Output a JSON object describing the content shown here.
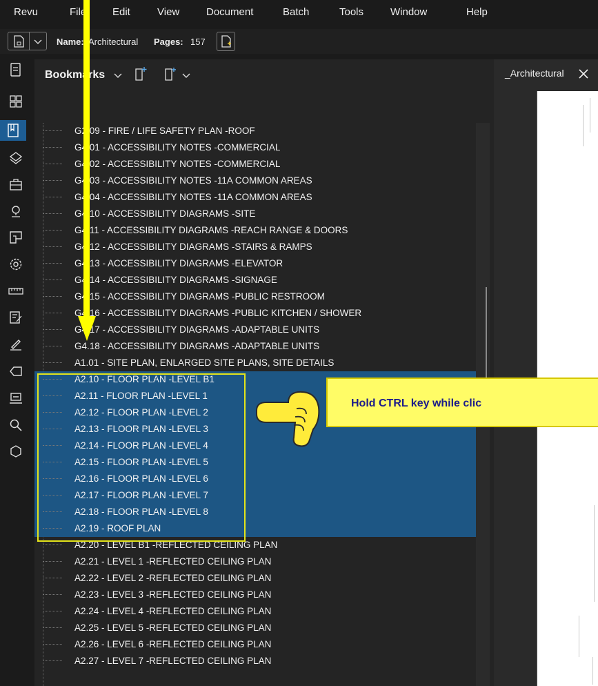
{
  "menubar": {
    "items": [
      "Revu",
      "File",
      "Edit",
      "View",
      "Document",
      "Batch",
      "Tools",
      "Window",
      "Help"
    ]
  },
  "toolbar": {
    "name_label": "Name:",
    "name_value": "Architectural",
    "pages_label": "Pages:",
    "pages_value": "157"
  },
  "sidebar_icons": [
    "page-icon",
    "thumbnails-icon",
    "bookmarks-icon",
    "layers-icon",
    "toolbox-icon",
    "markups-icon",
    "spaces-icon",
    "settings-icon",
    "measure-icon",
    "properties-icon",
    "signature-icon",
    "tags-icon",
    "studio-icon",
    "search-icon",
    "sets-icon"
  ],
  "panel": {
    "title": "Bookmarks"
  },
  "bookmarks": [
    {
      "label": "G2.09 - FIRE / LIFE SAFETY PLAN -ROOF",
      "selected": false
    },
    {
      "label": "G4.01 - ACCESSIBILITY NOTES -COMMERCIAL",
      "selected": false
    },
    {
      "label": "G4.02 - ACCESSIBILITY NOTES -COMMERCIAL",
      "selected": false
    },
    {
      "label": "G4.03 - ACCESSIBILITY NOTES -11A COMMON AREAS",
      "selected": false
    },
    {
      "label": "G4.04 - ACCESSIBILITY NOTES -11A COMMON AREAS",
      "selected": false
    },
    {
      "label": "G4.10 - ACCESSIBILITY DIAGRAMS -SITE",
      "selected": false
    },
    {
      "label": "G4.11 - ACCESSIBILITY DIAGRAMS -REACH RANGE & DOORS",
      "selected": false
    },
    {
      "label": "G4.12 - ACCESSIBILITY DIAGRAMS -STAIRS & RAMPS",
      "selected": false
    },
    {
      "label": "G4.13 - ACCESSIBILITY DIAGRAMS -ELEVATOR",
      "selected": false
    },
    {
      "label": "G4.14 - ACCESSIBILITY DIAGRAMS -SIGNAGE",
      "selected": false
    },
    {
      "label": "G4.15 - ACCESSIBILITY DIAGRAMS -PUBLIC RESTROOM",
      "selected": false
    },
    {
      "label": "G4.16 - ACCESSIBILITY DIAGRAMS -PUBLIC KITCHEN / SHOWER",
      "selected": false
    },
    {
      "label": "G4.17 - ACCESSIBILITY DIAGRAMS -ADAPTABLE UNITS",
      "selected": false
    },
    {
      "label": "G4.18 - ACCESSIBILITY DIAGRAMS -ADAPTABLE UNITS",
      "selected": false
    },
    {
      "label": "A1.01 - SITE PLAN, ENLARGED SITE PLANS, SITE DETAILS",
      "selected": false
    },
    {
      "label": "A2.10 - FLOOR PLAN -LEVEL B1",
      "selected": true
    },
    {
      "label": "A2.11 - FLOOR PLAN -LEVEL 1",
      "selected": true
    },
    {
      "label": "A2.12 - FLOOR PLAN -LEVEL 2",
      "selected": true
    },
    {
      "label": "A2.13 - FLOOR PLAN -LEVEL 3",
      "selected": true
    },
    {
      "label": "A2.14 - FLOOR PLAN -LEVEL 4",
      "selected": true
    },
    {
      "label": "A2.15 - FLOOR PLAN -LEVEL 5",
      "selected": true
    },
    {
      "label": "A2.16 - FLOOR PLAN -LEVEL 6",
      "selected": true
    },
    {
      "label": "A2.17 - FLOOR PLAN -LEVEL 7",
      "selected": true
    },
    {
      "label": "A2.18 - FLOOR PLAN -LEVEL 8",
      "selected": true
    },
    {
      "label": "A2.19 - ROOF PLAN",
      "selected": true
    },
    {
      "label": "A2.20 - LEVEL B1 -REFLECTED CEILING PLAN",
      "selected": false
    },
    {
      "label": "A2.21 - LEVEL 1 -REFLECTED CEILING PLAN",
      "selected": false
    },
    {
      "label": "A2.22 - LEVEL 2 -REFLECTED CEILING PLAN",
      "selected": false
    },
    {
      "label": "A2.23 - LEVEL 3 -REFLECTED CEILING PLAN",
      "selected": false
    },
    {
      "label": "A2.24 - LEVEL 4 -REFLECTED CEILING PLAN",
      "selected": false
    },
    {
      "label": "A2.25 - LEVEL 5 -REFLECTED CEILING PLAN",
      "selected": false
    },
    {
      "label": "A2.26 - LEVEL 6 -REFLECTED CEILING PLAN",
      "selected": false
    },
    {
      "label": "A2.27 - LEVEL 7 -REFLECTED CEILING PLAN",
      "selected": false
    }
  ],
  "viewer": {
    "tab_label": "_Architectural"
  },
  "callout": {
    "text": "Hold CTRL key while clic"
  },
  "colors": {
    "selection": "#1d5684",
    "accent": "#1d5d94",
    "annotation_yellow": "#ffff00",
    "callout_bg": "#fffc66",
    "callout_text": "#1c1c8a"
  }
}
